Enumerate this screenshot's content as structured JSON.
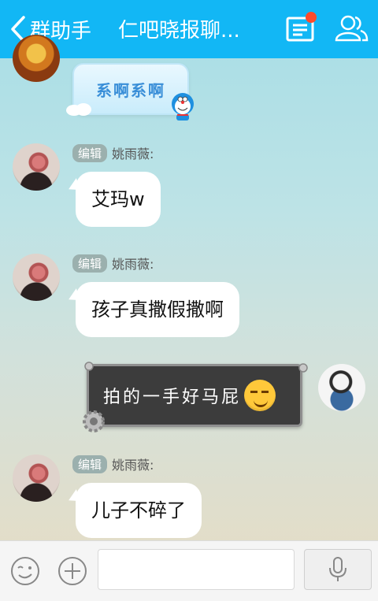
{
  "header": {
    "back_label": "群助手",
    "title": "仁吧晓报聊...",
    "bg_color": "#12b7f5",
    "notice_icon": "notice-icon",
    "group_icon": "group-members-icon"
  },
  "messages": [
    {
      "type": "sticker",
      "text": "系啊系啊",
      "sticker_icon": "doraemon-icon"
    },
    {
      "type": "text",
      "role": "编辑",
      "sender": "姚雨薇:",
      "text": "艾玛w"
    },
    {
      "type": "text",
      "role": "编辑",
      "sender": "姚雨薇:",
      "text": "孩子真撒假撒啊"
    },
    {
      "type": "mine",
      "text": "拍的一手好马屁",
      "emoji": "smirk-emoji"
    },
    {
      "type": "text",
      "role": "编辑",
      "sender": "姚雨薇:",
      "text": "儿子不碎了"
    }
  ],
  "inputbar": {
    "placeholder": "",
    "value": "",
    "emoji_icon": "wink-face-icon",
    "plus_icon": "plus-circle-icon",
    "voice_icon": "microphone-icon"
  }
}
